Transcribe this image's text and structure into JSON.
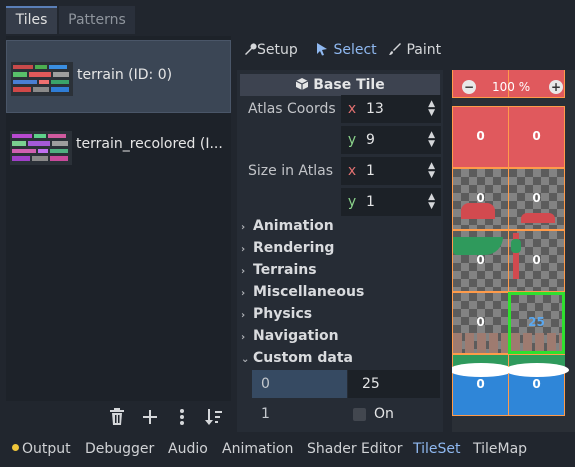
{
  "tabs": {
    "tiles": "Tiles",
    "patterns": "Patterns"
  },
  "sources": [
    {
      "label": "terrain (ID: 0)"
    },
    {
      "label": "terrain_recolored (I..."
    }
  ],
  "left_toolbar": {
    "icons": [
      "trash-icon",
      "add-icon",
      "more-vertical-icon",
      "sort-icon"
    ]
  },
  "mode_bar": {
    "setup": "Setup",
    "select": "Select",
    "paint": "Paint",
    "active": "Select"
  },
  "inspector": {
    "header": "Base Tile",
    "atlas_coords": {
      "label": "Atlas Coords",
      "x_tag": "x",
      "x": "13",
      "y_tag": "y",
      "y": "9"
    },
    "size_in_atlas": {
      "label": "Size in Atlas",
      "x_tag": "x",
      "x": "1",
      "y_tag": "y",
      "y": "1"
    },
    "sections": [
      "Animation",
      "Rendering",
      "Terrains",
      "Miscellaneous",
      "Physics",
      "Navigation",
      "Custom data"
    ],
    "custom_data": [
      {
        "key": "0",
        "value": "25"
      },
      {
        "key": "1",
        "value": "On"
      }
    ]
  },
  "atlas": {
    "zoom_out": "−",
    "zoom": "100 %",
    "zoom_in": "+",
    "cells": [
      "0",
      "0",
      "0",
      "0",
      "0",
      "0",
      "0",
      "0",
      "0",
      "25",
      "0",
      "0"
    ]
  },
  "bottom_bar": {
    "items": [
      "Output",
      "Debugger",
      "Audio",
      "Animation",
      "Shader Editor",
      "TileSet",
      "TileMap"
    ],
    "active": "TileSet"
  },
  "colors": {
    "accent": "#8fb8f0",
    "warning_dot": "#f0c63a",
    "selection": "#3b4655"
  }
}
